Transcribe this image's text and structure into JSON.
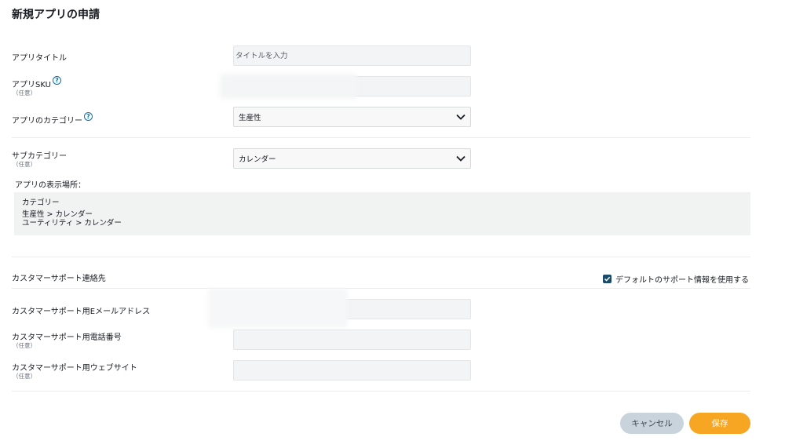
{
  "page": {
    "title": "新規アプリの申請"
  },
  "form": {
    "app_title": {
      "label": "アプリタイトル",
      "placeholder": "タイトルを入力"
    },
    "app_sku": {
      "label": "アプリSKU",
      "optional": "（任意）"
    },
    "category": {
      "label": "アプリのカテゴリー",
      "value": "生産性"
    },
    "subcategory": {
      "label": "サブカテゴリー",
      "optional": "（任意）",
      "value": "カレンダー"
    },
    "placement": {
      "heading": "アプリの表示場所：",
      "title": "カテゴリー",
      "paths": [
        "生産性 > カレンダー",
        "ユーティリティ > カレンダー"
      ]
    },
    "support": {
      "section_label": "カスタマーサポート連絡先",
      "use_default_label": "デフォルトのサポート情報を使用する",
      "use_default_checked": true,
      "email": {
        "label": "カスタマーサポート用Eメールアドレス"
      },
      "phone": {
        "label": "カスタマーサポート用電話番号",
        "optional": "（任意）"
      },
      "website": {
        "label": "カスタマーサポート用ウェブサイト",
        "optional": "（任意）"
      }
    }
  },
  "actions": {
    "cancel": "キャンセル",
    "save": "保存"
  },
  "colors": {
    "accent": "#f6a623",
    "link": "#0073bb",
    "checkbox": "#1d4c6a",
    "cancel_bg": "#c9d3dc"
  },
  "icons": {
    "help": "help-circle-icon",
    "chevron": "chevron-down-icon",
    "check": "check-icon"
  }
}
